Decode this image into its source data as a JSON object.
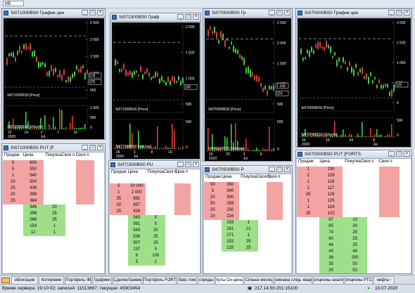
{
  "toolbar": {
    "timeframe": "M5"
  },
  "charts": [
    {
      "title": "Si071000BS0 График цен",
      "price_label": "Si071000BS0 [Price]",
      "volume_label": "Si071000BS0 [Volume]",
      "price_ticks": [
        "2 500",
        "2 000",
        "1 500",
        "1 000",
        "500"
      ],
      "price_tags": [
        "578",
        "375"
      ],
      "volume_ticks": [
        "1 000",
        "500",
        "0"
      ],
      "date_ticks": [
        "22",
        "19",
        "2",
        "7",
        "10"
      ],
      "date_sub": [
        "2020",
        "",
        "Jul",
        "",
        ""
      ]
    },
    {
      "title": "Si071500BS0 Граф",
      "price_label": "Si071500BS0 [Price]",
      "volume_label": "Si071500BS0 [Volume]",
      "price_ticks": [
        "2 000",
        "1 500",
        "1 000",
        "500"
      ],
      "price_tags": [
        "160"
      ],
      "volume_ticks": [
        "500",
        "0"
      ],
      "date_ticks": [
        "26",
        "3",
        "8",
        "10"
      ],
      "date_sub": [
        "2020",
        "Jul",
        "",
        ""
      ]
    },
    {
      "title": "Si070500BS0 Гр",
      "price_label": "Si070500BS0 [Price]",
      "volume_label": "Si070500BS0 [Volume]",
      "price_ticks": [
        "2 500",
        "2 000",
        "1 500",
        "1 000",
        "500"
      ],
      "price_tags": [
        "1 100",
        "224"
      ],
      "volume_ticks": [
        "500",
        "0"
      ],
      "date_ticks": [
        "19",
        "22",
        "3",
        "9"
      ],
      "date_sub": [
        "2020",
        "",
        "Jul",
        ""
      ]
    },
    {
      "title": "Si070000BS0 График цен",
      "price_label": "Si070000BS0 [Price]",
      "volume_label": "Si070000BS0 [Volume]",
      "price_ticks": [
        "2 000",
        "1 500",
        "1 000",
        "500",
        "0"
      ],
      "price_tags": [
        "125"
      ],
      "volume_ticks": [
        "500",
        "0"
      ],
      "date_ticks": [
        "24",
        "19",
        "24",
        "8"
      ],
      "date_sub": [
        "2020",
        "",
        "",
        "Jul"
      ]
    }
  ],
  "books": [
    {
      "title": "Si071000BS0 PUT [F",
      "headers": [
        "Продаж",
        "Цена",
        "ПокупкаСвоя п",
        "Своя п"
      ],
      "rows": [
        {
          "sell": "5",
          "price": "600",
          "buy": ""
        },
        {
          "sell": "5",
          "price": "550",
          "buy": ""
        },
        {
          "sell": "1",
          "price": "540",
          "buy": ""
        },
        {
          "sell": "10",
          "price": "500",
          "buy": ""
        },
        {
          "sell": "25",
          "price": "436",
          "buy": ""
        },
        {
          "sell": "20",
          "price": "399",
          "buy": ""
        },
        {
          "sell": "25",
          "price": "384",
          "buy": ""
        },
        {
          "sell": "",
          "price": "346",
          "buy": "20"
        },
        {
          "sell": "",
          "price": "298",
          "buy": "25"
        },
        {
          "sell": "",
          "price": "266",
          "buy": "25"
        },
        {
          "sell": "",
          "price": "154",
          "buy": "1"
        },
        {
          "sell": "",
          "price": "12",
          "buy": "1"
        }
      ]
    },
    {
      "title": "Si071500BS0 PU",
      "headers": [
        "Продаж",
        "Цена",
        "ПокупкаСвоя п",
        "Своя п"
      ],
      "rows": [
        {
          "sell": "",
          "price": "",
          "buy": ""
        },
        {
          "sell": "5",
          "price": "20 000",
          "buy": ""
        },
        {
          "sell": "1",
          "price": "2 000",
          "buy": ""
        },
        {
          "sell": "25",
          "price": "681",
          "buy": ""
        },
        {
          "sell": "20",
          "price": "657",
          "buy": ""
        },
        {
          "sell": "25",
          "price": "626",
          "buy": ""
        },
        {
          "sell": "",
          "price": "583",
          "buy": "5"
        },
        {
          "sell": "",
          "price": "581",
          "buy": "5"
        },
        {
          "sell": "",
          "price": "543",
          "buy": "20"
        },
        {
          "sell": "",
          "price": "536",
          "buy": "25"
        },
        {
          "sell": "",
          "price": "507",
          "buy": "25"
        },
        {
          "sell": "",
          "price": "137",
          "buy": "5"
        },
        {
          "sell": "",
          "price": "6",
          "buy": "100"
        },
        {
          "sell": "",
          "price": "5",
          "buy": "1"
        }
      ]
    },
    {
      "title": "Si070500BS0 P",
      "headers": [
        "Продаж",
        "Цена",
        "ПокупкаСвоя п",
        "Своя п"
      ],
      "rows": [
        {
          "sell": "50",
          "price": "350",
          "buy": ""
        },
        {
          "sell": "5",
          "price": "340",
          "buy": ""
        },
        {
          "sell": "20",
          "price": "300",
          "buy": ""
        },
        {
          "sell": "50",
          "price": "259",
          "buy": ""
        },
        {
          "sell": "25",
          "price": "250",
          "buy": ""
        },
        {
          "sell": "20",
          "price": "234",
          "buy": ""
        },
        {
          "sell": "",
          "price": "193",
          "buy": "1"
        },
        {
          "sell": "",
          "price": "181",
          "buy": "21"
        },
        {
          "sell": "",
          "price": "171",
          "buy": "1"
        },
        {
          "sell": "",
          "price": "153",
          "buy": "25"
        },
        {
          "sell": "",
          "price": "125",
          "buy": "25"
        }
      ]
    },
    {
      "title": "Si070000BS0 PUT [FORTS",
      "headers": [
        "Продаж",
        "Цена",
        "ПокупкаСвоя п",
        "Своя п"
      ],
      "rows": [
        {
          "sell": "1",
          "price": "130",
          "buy": ""
        },
        {
          "sell": "2",
          "price": "129",
          "buy": ""
        },
        {
          "sell": "1",
          "price": "128",
          "buy": ""
        },
        {
          "sell": "1",
          "price": "127",
          "buy": ""
        },
        {
          "sell": "26",
          "price": "126",
          "buy": ""
        },
        {
          "sell": "1",
          "price": "125",
          "buy": ""
        },
        {
          "sell": "1",
          "price": "124",
          "buy": ""
        },
        {
          "sell": "25",
          "price": "123",
          "buy": ""
        },
        {
          "sell": "",
          "price": "87",
          "buy": "10"
        },
        {
          "sell": "",
          "price": "85",
          "buy": "20"
        },
        {
          "sell": "",
          "price": "74",
          "buy": "25"
        },
        {
          "sell": "",
          "price": "60",
          "buy": "25"
        },
        {
          "sell": "",
          "price": "44",
          "buy": "25"
        },
        {
          "sell": "",
          "price": "40",
          "buy": "49"
        },
        {
          "sell": "",
          "price": "38",
          "buy": "200"
        },
        {
          "sell": "",
          "price": "35",
          "buy": "50"
        },
        {
          "sell": "",
          "price": "30",
          "buy": "53"
        }
      ]
    }
  ],
  "tabs": [
    "облигации",
    "Котировки",
    "Портфель ФР",
    "Графики",
    "Сделки/Заявки",
    "Портфель FORTS",
    "бакс-том",
    "спреды",
    "путы Си-цены",
    "Сі/нька месяц",
    "смешка след. квартал",
    "опционы анализ",
    "опционы РТС",
    "нефть~"
  ],
  "status": {
    "server_time": "Время сервера: 19:10:02; записей: 11513867; текущая: 45903454",
    "connection": "217.14.50.201:15100",
    "date": "10.07.2020"
  },
  "colors": {
    "sell": "#f4a3a3",
    "buy": "#9ee08a",
    "chart_bg": "#000000",
    "active_tab": "#ffffff"
  }
}
